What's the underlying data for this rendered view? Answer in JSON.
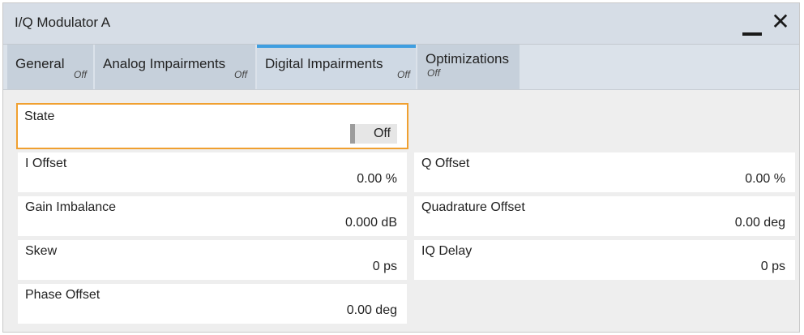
{
  "window": {
    "title": "I/Q Modulator A",
    "minimize_icon": "minimize-icon",
    "close_icon": "close-icon",
    "close_glyph": "✕"
  },
  "tabs": [
    {
      "label": "General",
      "status": "Off"
    },
    {
      "label": "Analog Impairments",
      "status": "Off"
    },
    {
      "label": "Digital Impairments",
      "status": "Off",
      "active": true
    },
    {
      "label": "Optimizations",
      "status": "Off"
    }
  ],
  "state": {
    "label": "State",
    "value": "Off"
  },
  "fields": {
    "i_offset": {
      "label": "I Offset",
      "value": "0.00 %"
    },
    "q_offset": {
      "label": "Q Offset",
      "value": "0.00 %"
    },
    "gain_imbalance": {
      "label": "Gain Imbalance",
      "value": "0.000 dB"
    },
    "quadrature_offset": {
      "label": "Quadrature Offset",
      "value": "0.00 deg"
    },
    "skew": {
      "label": "Skew",
      "value": "0 ps"
    },
    "iq_delay": {
      "label": "IQ Delay",
      "value": "0 ps"
    },
    "phase_offset": {
      "label": "Phase Offset",
      "value": "0.00 deg"
    }
  },
  "colors": {
    "accent": "#3f9ee0",
    "focus_border": "#f0a030",
    "titlebar": "#d6dde6",
    "tab_bg": "#c6d0db"
  }
}
